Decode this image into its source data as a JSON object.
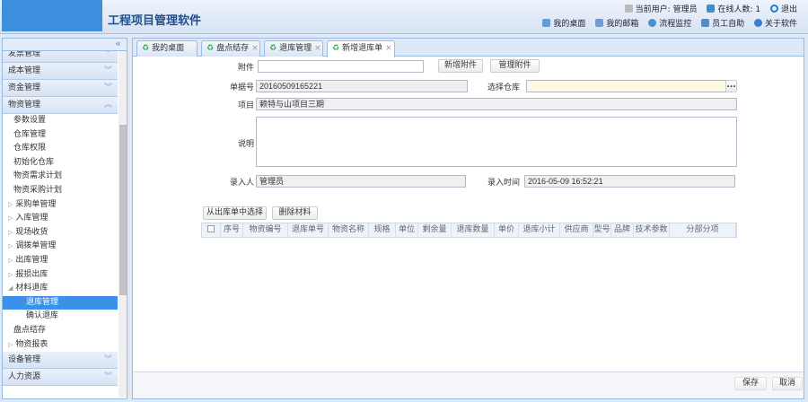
{
  "header": {
    "title": "工程项目管理软件",
    "current_user_label": "当前用户: 管理员",
    "online_label": "在线人数:",
    "online_count": "1",
    "logout": "退出",
    "nav": [
      "我的桌面",
      "我的邮箱",
      "流程监控",
      "员工自助",
      "关于软件"
    ]
  },
  "sidebar": {
    "top_groups": [
      "发票管理",
      "成本管理",
      "资金管理",
      "物资管理"
    ],
    "items": [
      {
        "label": "参数设置",
        "type": "leaf"
      },
      {
        "label": "仓库管理",
        "type": "leaf"
      },
      {
        "label": "仓库权限",
        "type": "leaf"
      },
      {
        "label": "初始化仓库",
        "type": "leaf"
      },
      {
        "label": "物资需求计划",
        "type": "leaf"
      },
      {
        "label": "物资采购计划",
        "type": "leaf"
      },
      {
        "label": "采购单管理",
        "type": "folder"
      },
      {
        "label": "入库管理",
        "type": "folder"
      },
      {
        "label": "现场收货",
        "type": "folder"
      },
      {
        "label": "调拨单管理",
        "type": "folder"
      },
      {
        "label": "出库管理",
        "type": "folder"
      },
      {
        "label": "报损出库",
        "type": "folder"
      },
      {
        "label": "材料退库",
        "type": "open"
      },
      {
        "label": "退库管理",
        "type": "child",
        "selected": true
      },
      {
        "label": "确认退库",
        "type": "child"
      },
      {
        "label": "盘点结存",
        "type": "leaf"
      },
      {
        "label": "物资报表",
        "type": "folder"
      }
    ],
    "bottom_groups": [
      "设备管理",
      "人力资源"
    ]
  },
  "tabs": [
    {
      "label": "我的桌面",
      "closable": false
    },
    {
      "label": "盘点结存",
      "closable": true
    },
    {
      "label": "退库管理",
      "closable": true
    },
    {
      "label": "新增退库单",
      "closable": true,
      "active": true
    }
  ],
  "form": {
    "attachment_label": "附件",
    "attachment_value": "",
    "add_attachment": "新增附件",
    "manage_attachment": "管理附件",
    "doc_no_label": "单据号",
    "doc_no": "20160509165221",
    "warehouse_label": "选择仓库",
    "warehouse_value": "",
    "browse": "...",
    "project_label": "项目",
    "project": "赖特与山项目三期",
    "remark_label": "说明",
    "remark": "",
    "entered_by_label": "录入人",
    "entered_by": "管理员",
    "entry_time_label": "录入时间",
    "entry_time": "2016-05-09 16:52:21"
  },
  "grid": {
    "select_from_outbound": "从出库单中选择",
    "delete_material": "删除材料",
    "columns": [
      "序号",
      "物资编号",
      "退库单号",
      "物资名称",
      "规格",
      "单位",
      "剩余量",
      "退库数量",
      "单价",
      "退库小计",
      "供应商",
      "型号",
      "品牌",
      "技术参数",
      "分部分项"
    ]
  },
  "footer": {
    "save": "保存",
    "cancel": "取消"
  }
}
